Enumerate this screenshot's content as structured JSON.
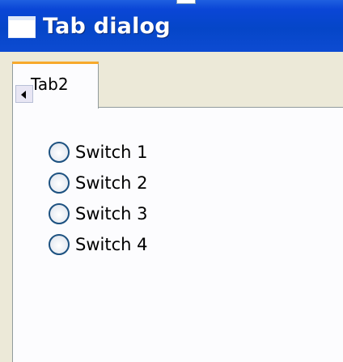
{
  "window": {
    "title": "Tab dialog"
  },
  "tabs": [
    {
      "label": "Tab2",
      "active": true
    }
  ],
  "tab_scroll": {
    "icon": "triangle-left-icon"
  },
  "radio_buttons": [
    {
      "label": "Switch 1",
      "checked": false
    },
    {
      "label": "Switch 2",
      "checked": false
    },
    {
      "label": "Switch 3",
      "checked": false
    },
    {
      "label": "Switch 4",
      "checked": false
    }
  ],
  "colors": {
    "titlebar": "#0546c8",
    "tab_accent": "#f7a92b",
    "pane_background": "#fcfcfe",
    "dialog_background": "#ece9d8"
  }
}
